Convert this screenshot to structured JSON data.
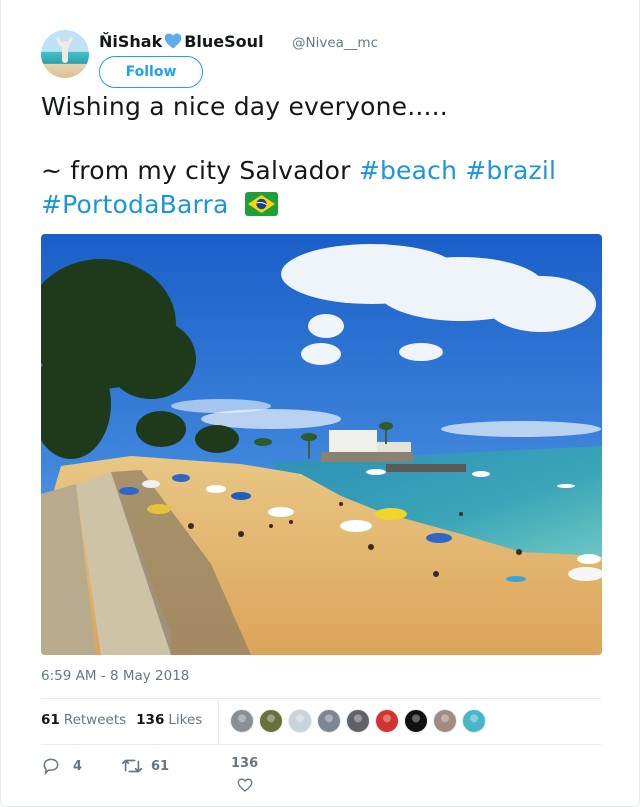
{
  "author": {
    "name_part1": "ŇiShak",
    "name_part2": "BlueSoul",
    "handle": "@Nivea__mc",
    "follow_label": "Follow"
  },
  "tweet": {
    "line1": "Wishing a nice day everyone.....",
    "line2_prefix": "~ from my city Salvador",
    "hashtags": [
      "#beach",
      "#brazil",
      "#PortodaBarra"
    ],
    "timestamp": "6:59 AM - 8 May 2018"
  },
  "stats": {
    "retweets_count": "61",
    "retweets_label": "Retweets",
    "likes_count": "136",
    "likes_label": "Likes"
  },
  "likers": [
    {
      "icon": "avatar-grey-figure",
      "color": "#8a8f94"
    },
    {
      "icon": "avatar-man-olive",
      "color": "#6b6f3a"
    },
    {
      "icon": "avatar-default",
      "color": "#c8d3dc"
    },
    {
      "icon": "avatar-man-cap",
      "color": "#7d8691"
    },
    {
      "icon": "avatar-mono",
      "color": "#5f6368"
    },
    {
      "icon": "avatar-red-art",
      "color": "#d0342c"
    },
    {
      "icon": "avatar-black-round",
      "color": "#111111"
    },
    {
      "icon": "avatar-person",
      "color": "#a08c80"
    },
    {
      "icon": "avatar-beach",
      "color": "#46b6c8"
    }
  ],
  "actions": {
    "reply_count": "4",
    "retweet_count": "61",
    "like_count": "136"
  },
  "colors": {
    "accent": "#1da1f2",
    "hashtag": "#1b95e0",
    "muted": "#657786",
    "heart_emoji": "#5dadec"
  }
}
